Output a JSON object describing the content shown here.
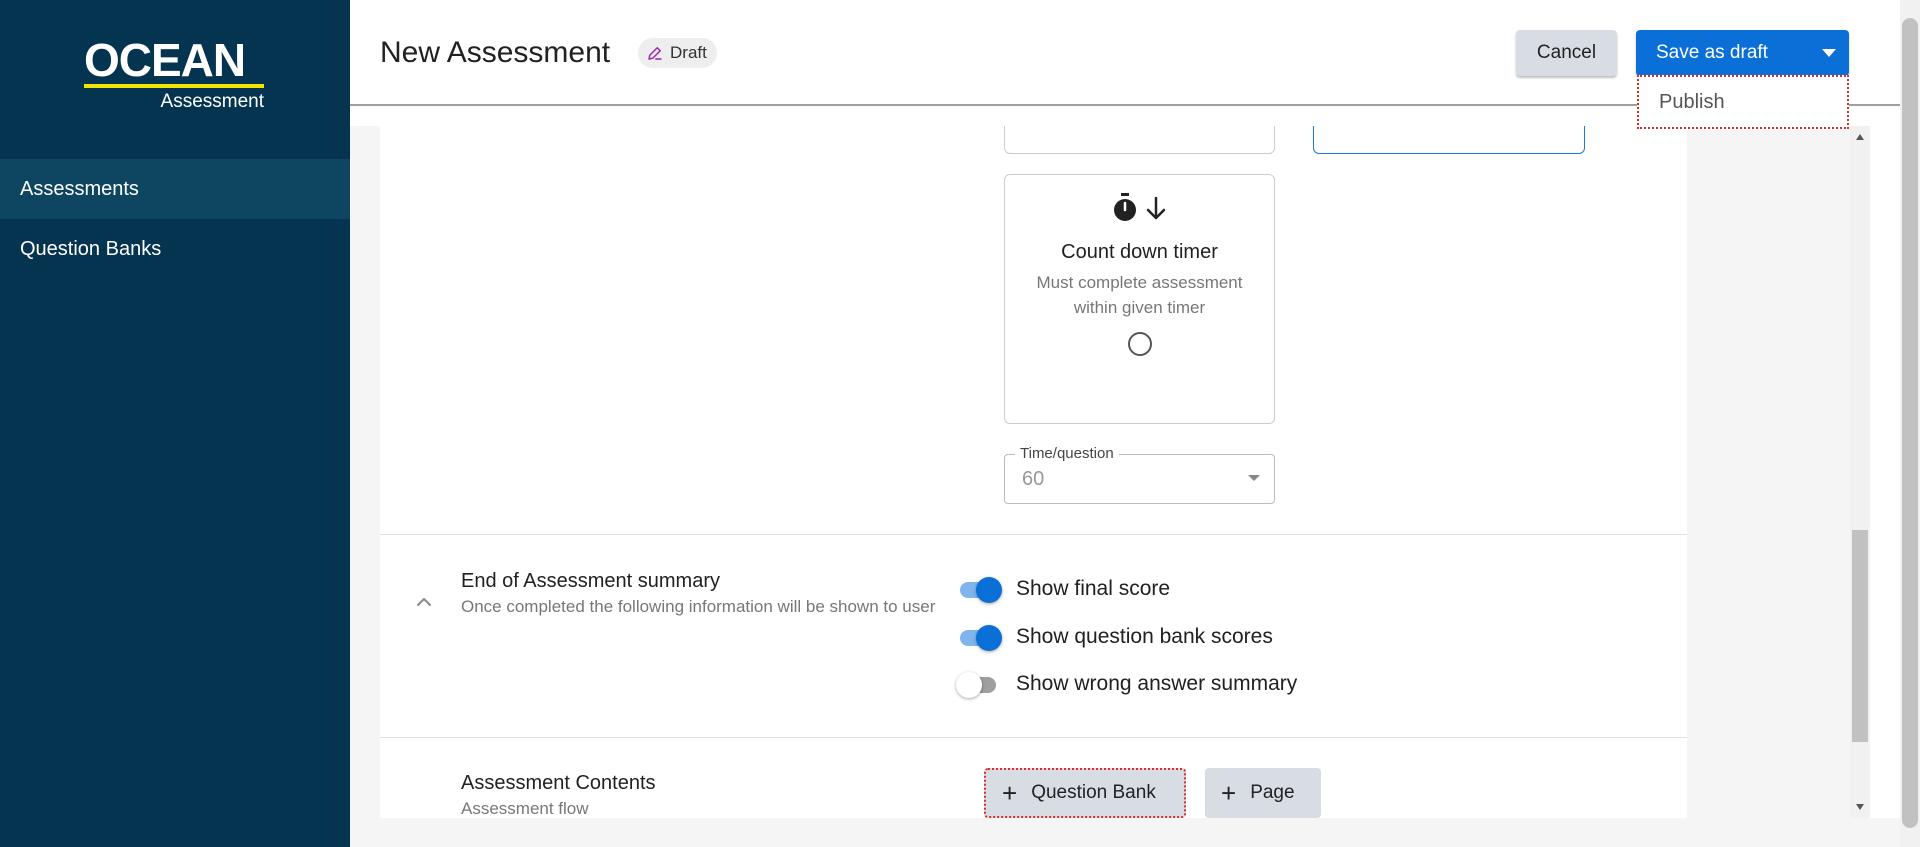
{
  "sidebar": {
    "logo": {
      "main": "OCEAN",
      "sub": "Assessment",
      "accent_color": "#f2e500"
    },
    "bg_color": "#04344f",
    "items": [
      {
        "label": "Assessments",
        "active": true
      },
      {
        "label": "Question Banks",
        "active": false
      }
    ]
  },
  "header": {
    "title": "New Assessment",
    "status_badge": {
      "label": "Draft",
      "icon": "edit-pencil-icon"
    },
    "cancel_label": "Cancel",
    "save_label": "Save as draft",
    "save_color": "#0b6fd8",
    "dropdown_items": [
      "Publish"
    ]
  },
  "timer": {
    "countdown_card": {
      "icons": [
        "stopwatch-icon",
        "arrow-down-icon"
      ],
      "title": "Count down timer",
      "description": "Must complete assessment within given timer",
      "selected": false
    },
    "time_per_question": {
      "label": "Time/question",
      "value": "60"
    }
  },
  "summary": {
    "title": "End of Assessment summary",
    "description": "Once completed the following information will be shown to user",
    "toggles": [
      {
        "label": "Show final score",
        "on": true
      },
      {
        "label": "Show question bank scores",
        "on": true
      },
      {
        "label": "Show wrong answer summary",
        "on": false
      }
    ]
  },
  "contents": {
    "title": "Assessment Contents",
    "description": "Assessment flow",
    "add_question_bank_label": "Question Bank",
    "add_page_label": "Page"
  }
}
